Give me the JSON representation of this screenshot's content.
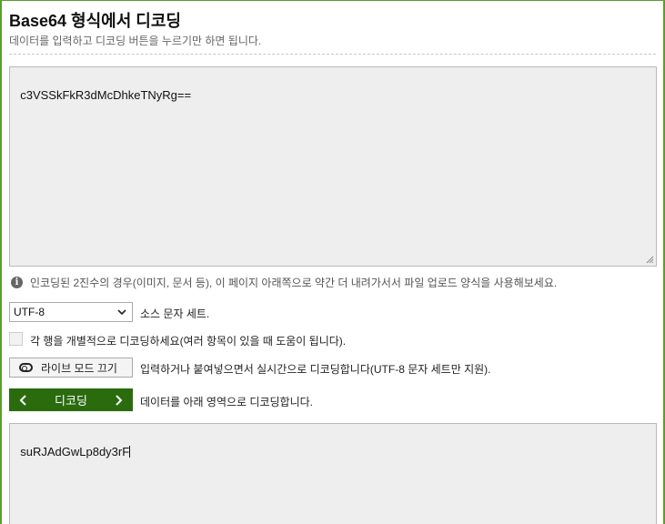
{
  "page": {
    "title": "Base64 형식에서 디코딩",
    "subtitle": "데이터를 입력하고 디코딩 버튼을 누르기만 하면 됩니다."
  },
  "input": {
    "value": "c3VSSkFkR3dMcDhkeTNyRg=="
  },
  "info": {
    "text": "인코딩된 2진수의 경우(이미지, 문서 등), 이 페이지 아래쪽으로 약간 더 내려가서서 파일 업로드 양식을 사용해보세요."
  },
  "charset": {
    "selected": "UTF-8",
    "label": "소스 문자 세트."
  },
  "per_line": {
    "label": "각 행을 개별적으로 디코딩하세요(여러 항목이 있을 때 도움이 됩니다)."
  },
  "live_mode": {
    "button_label": "라이브 모드 끄기",
    "description": "입력하거나 붙여넣으면서 실시간으로 디코딩합니다(UTF-8 문자 세트만 지원)."
  },
  "decode": {
    "button_label": "디코딩",
    "description": "데이터를 아래 영역으로 디코딩합니다."
  },
  "output": {
    "value": "suRJAdGwLp8dy3rF"
  },
  "colors": {
    "accent": "#2a6b0e",
    "frame": "#5a9e2e"
  }
}
